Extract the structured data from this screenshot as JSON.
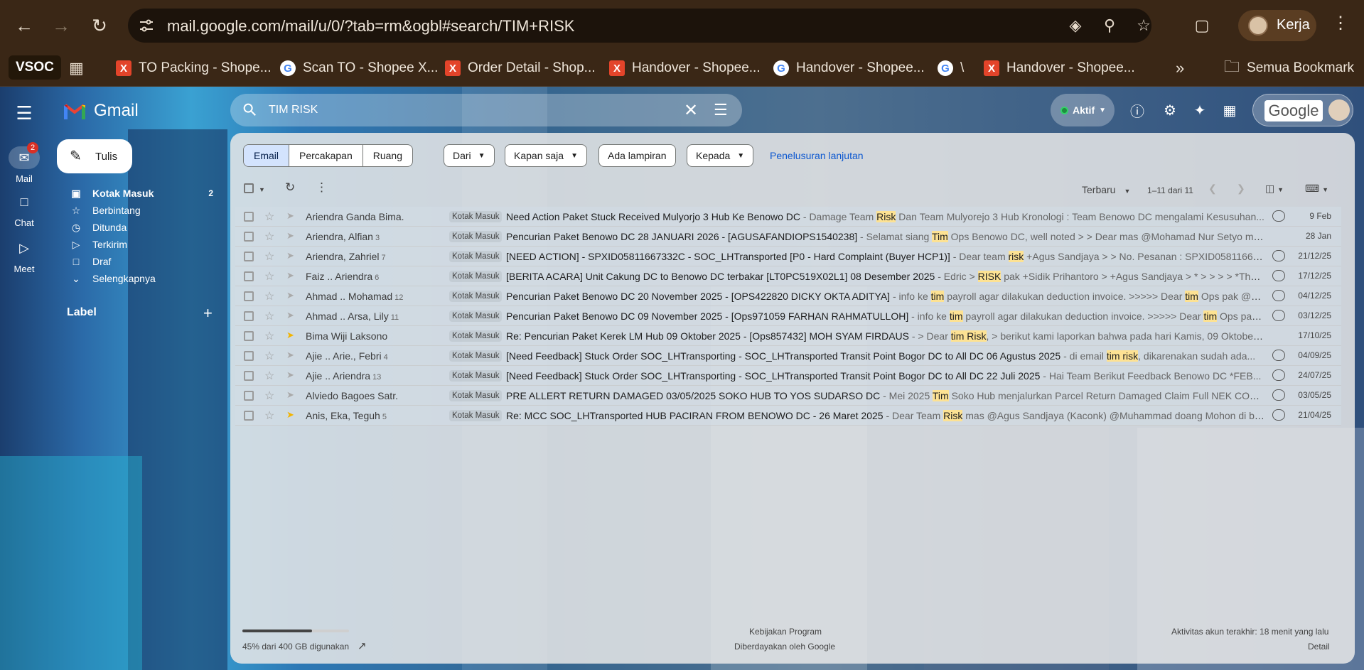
{
  "browser": {
    "url": "mail.google.com/mail/u/0/?tab=rm&ogbl#search/TIM+RISK",
    "profile_name": "Kerja",
    "bookmarks": [
      {
        "label": "VSOC",
        "icon": "vsoc"
      },
      {
        "label": "TO Packing - Shope...",
        "icon": "x-favicon"
      },
      {
        "label": "Scan TO - Shopee X...",
        "icon": "google-favicon"
      },
      {
        "label": "Order Detail - Shop...",
        "icon": "x-favicon"
      },
      {
        "label": "Handover - Shopee...",
        "icon": "x-favicon"
      },
      {
        "label": "Handover - Shopee...",
        "icon": "google-favicon"
      },
      {
        "label": "\\",
        "icon": "google-favicon"
      },
      {
        "label": "Handover - Shopee...",
        "icon": "x-favicon"
      }
    ],
    "all_bookmarks": "Semua Bookmark"
  },
  "gmail": {
    "app_name": "Gmail",
    "search_query": "TIM RISK",
    "status": "Aktif",
    "google_wordmark": "Google",
    "compose_label": "Tulis",
    "rail": [
      {
        "label": "Mail",
        "badge": "2"
      },
      {
        "label": "Chat"
      },
      {
        "label": "Meet"
      }
    ],
    "folders": [
      {
        "label": "Kotak Masuk",
        "count": "2",
        "icon": "inbox-icon"
      },
      {
        "label": "Berbintang",
        "count": "",
        "icon": "star-icon"
      },
      {
        "label": "Ditunda",
        "count": "",
        "icon": "clock-icon"
      },
      {
        "label": "Terkirim",
        "count": "",
        "icon": "send-icon"
      },
      {
        "label": "Draf",
        "count": "",
        "icon": "draft-icon"
      },
      {
        "label": "Selengkapnya",
        "count": "",
        "icon": "chevron-down-icon"
      }
    ],
    "labels_heading": "Label",
    "scope_tabs": [
      "Email",
      "Percakapan",
      "Ruang"
    ],
    "filters": [
      "Dari",
      "Kapan saja",
      "Ada lampiran",
      "Kepada"
    ],
    "advanced_search": "Penelusuran lanjutan",
    "sort": "Terbaru",
    "range": "1–11 dari 11",
    "emails": [
      {
        "sender": "Ariendra Ganda Bima.",
        "count": "",
        "label": "Kotak Masuk",
        "subject": "Need Action Paket Stuck Received Mulyorjo 3 Hub Ke Benowo DC",
        "snippet_parts": [
          " - Damage Team ",
          "Risk",
          " Dan Team Mulyorejo 3 Hub Kronologi : Team Benowo DC mengalami Kesusuhan..."
        ],
        "date": "9 Feb",
        "attachment": true,
        "important": false
      },
      {
        "sender": "Ariendra, Alfian",
        "count": "3",
        "label": "Kotak Masuk",
        "subject": "Pencurian Paket Benowo DC 28 JANUARI 2026 - [AGUSAFANDIOPS1540238]",
        "snippet_parts": [
          " - Selamat siang ",
          "Tim",
          " Ops Benowo DC, well noted > > Dear mas @Mohamad Nur Setyo moh..."
        ],
        "date": "28 Jan",
        "attachment": false,
        "important": false
      },
      {
        "sender": "Ariendra, Zahriel",
        "count": "7",
        "label": "Kotak Masuk",
        "subject": "[NEED ACTION] - SPXID05811667332C - SOC_LHTransported [P0 - Hard Complaint (Buyer HCP1)]",
        "snippet_parts": [
          " - Dear team ",
          "risk",
          " +Agus Sandjaya > > No. Pesanan : SPXID0581166733..."
        ],
        "date": "21/12/25",
        "attachment": true,
        "important": false
      },
      {
        "sender": "Faiz .. Ariendra",
        "count": "6",
        "label": "Kotak Masuk",
        "subject": "[BERITA ACARA] Unit Cakung DC to Benowo DC terbakar [LT0PC519X02L1] 08 Desember 2025",
        "snippet_parts": [
          " - Edric > ",
          "RISK",
          " pak +Sidik Prihantoro > +Agus Sandjaya > * > > > > *Thank..."
        ],
        "date": "17/12/25",
        "attachment": true,
        "important": false
      },
      {
        "sender": "Ahmad .. Mohamad",
        "count": "12",
        "label": "Kotak Masuk",
        "subject": "Pencurian Paket Benowo DC 20 November 2025 - [OPS422820 DICKY OKTA ADITYA]",
        "snippet_parts": [
          " - info ke ",
          "tim",
          " payroll agar dilakukan deduction invoice. >>>>> Dear ",
          "tim",
          " Ops pak @R..."
        ],
        "date": "04/12/25",
        "attachment": true,
        "important": false
      },
      {
        "sender": "Ahmad .. Arsa, Lily",
        "count": "11",
        "label": "Kotak Masuk",
        "subject": "Pencurian Paket Benowo DC 09 November 2025 - [Ops971059 FARHAN RAHMATULLOH]",
        "snippet_parts": [
          " - info ke ",
          "tim",
          " payroll agar dilakukan deduction invoice. >>>>> Dear ",
          "tim",
          " Ops pak..."
        ],
        "date": "03/12/25",
        "attachment": true,
        "important": false
      },
      {
        "sender": "Bima Wiji Laksono",
        "count": "",
        "label": "Kotak Masuk",
        "subject": "Re: Pencurian Paket Kerek LM Hub 09 Oktober 2025 - [Ops857432] MOH SYAM FIRDAUS",
        "snippet_parts": [
          " - > Dear ",
          "tim Risk",
          ", > berikut kami laporkan bahwa pada hari Kamis, 09 Oktober ..."
        ],
        "date": "17/10/25",
        "attachment": false,
        "important": true
      },
      {
        "sender": "Ajie .. Arie., Febri",
        "count": "4",
        "label": "Kotak Masuk",
        "subject": "[Need Feedback] Stuck Order SOC_LHTransporting - SOC_LHTransported Transit Point Bogor DC to All DC 06 Agustus 2025",
        "snippet_parts": [
          " - di email ",
          "tim risk",
          ", dikarenakan sudah ada..."
        ],
        "date": "04/09/25",
        "attachment": true,
        "important": false
      },
      {
        "sender": "Ajie .. Ariendra",
        "count": "13",
        "label": "Kotak Masuk",
        "subject": "[Need Feedback] Stuck Order SOC_LHTransporting - SOC_LHTransported Transit Point Bogor DC to All DC 22 Juli 2025",
        "snippet_parts": [
          " - Hai Team Berikut Feedback Benowo DC *FEB..."
        ],
        "date": "24/07/25",
        "attachment": true,
        "important": false
      },
      {
        "sender": "Alviedo Bagoes Satr.",
        "count": "",
        "label": "Kotak Masuk",
        "subject": "PRE ALLERT RETURN DAMAGED 03/05/2025 SOKO HUB TO YOS SUDARSO DC",
        "snippet_parts": [
          " - Mei 2025 ",
          "Tim",
          " Soko Hub menjalurkan Parcel Return Damaged Claim Full NEK COMPAN..."
        ],
        "date": "03/05/25",
        "attachment": true,
        "important": false
      },
      {
        "sender": "Anis, Eka, Teguh",
        "count": "5",
        "label": "Kotak Masuk",
        "subject": "Re: MCC SOC_LHTransported HUB PACIRAN FROM BENOWO DC - 26 Maret 2025",
        "snippet_parts": [
          " - Dear Team ",
          "Risk",
          " mas @Agus Sandjaya (Kaconk) @Muhammad doang Mohon di ban..."
        ],
        "date": "21/04/25",
        "attachment": true,
        "important": true
      }
    ],
    "footer": {
      "storage": "45% dari 400 GB digunakan",
      "storage_fraction": 0.45,
      "policy": "Kebijakan Program",
      "powered": "Diberdayakan oleh Google",
      "activity": "Aktivitas akun terakhir: 18 menit yang lalu",
      "details": "Detail"
    }
  }
}
